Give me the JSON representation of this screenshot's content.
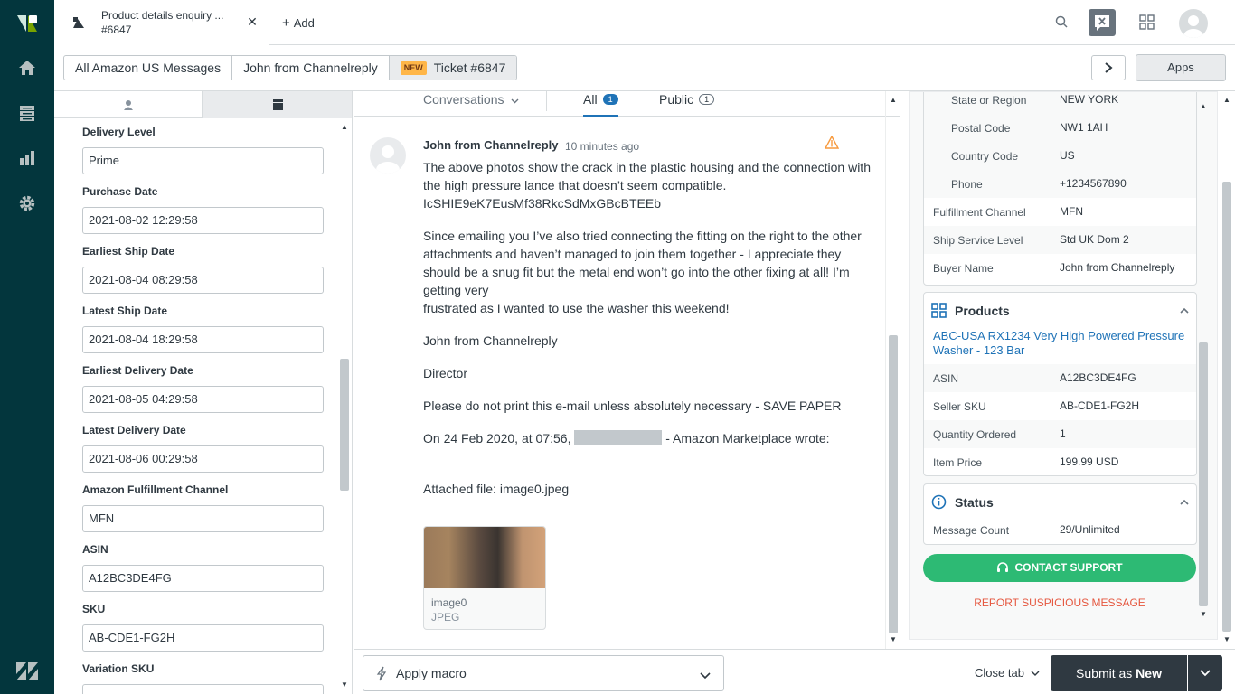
{
  "tabs": {
    "active": {
      "title": "Product details enquiry ...",
      "subtitle": "#6847"
    },
    "add_label": "Add"
  },
  "breadcrumbs": [
    {
      "label": "All Amazon US Messages"
    },
    {
      "label": "John from Channelreply"
    },
    {
      "badge": "NEW",
      "label": "Ticket #6847"
    }
  ],
  "apps_label": "Apps",
  "left_panel": {
    "fields": [
      {
        "label": "Delivery Level",
        "value": "Prime"
      },
      {
        "label": "Purchase Date",
        "value": "2021-08-02 12:29:58"
      },
      {
        "label": "Earliest Ship Date",
        "value": "2021-08-04 08:29:58"
      },
      {
        "label": "Latest Ship Date",
        "value": "2021-08-04 18:29:58"
      },
      {
        "label": "Earliest Delivery Date",
        "value": "2021-08-05 04:29:58"
      },
      {
        "label": "Latest Delivery Date",
        "value": "2021-08-06 00:29:58"
      },
      {
        "label": "Amazon Fulfillment Channel",
        "value": "MFN"
      },
      {
        "label": "ASIN",
        "value": "A12BC3DE4FG"
      },
      {
        "label": "SKU",
        "value": "AB-CDE1-FG2H"
      },
      {
        "label": "Variation SKU",
        "value": ""
      }
    ]
  },
  "conversation": {
    "filter_label": "Conversations",
    "all_label": "All",
    "all_count": "1",
    "public_label": "Public",
    "public_count": "1",
    "message": {
      "author": "John from Channelreply",
      "time": "10 minutes ago",
      "p1": "The above photos show the crack in the plastic housing and the connection with the high pressure lance that doesn’t seem compatible.",
      "p1b": "IcSHIE9eK7EusMf38RkcSdMxGBcBTEEb",
      "p2a": "Since emailing you I’ve also tried connecting the fitting on the right to the other attachments and haven’t managed to join them together - I appreciate they should be a snug fit but the metal end won’t go into the other fixing at all! I’m getting very",
      "p2b": "frustrated as I wanted to use the washer this weekend!",
      "p3": "John from Channelreply",
      "p4": "Director",
      "p5": "Please do not print this e-mail unless absolutely necessary - SAVE PAPER",
      "p6a": "On 24 Feb 2020, at 07:56,",
      "p6b": "- Amazon Marketplace wrote:",
      "p7": "Attached file: image0.jpeg",
      "attachment_name": "image0",
      "attachment_type": "JPEG"
    }
  },
  "bottom": {
    "macro_label": "Apply macro",
    "close_tab_label": "Close tab",
    "submit_prefix": "Submit as",
    "submit_status": "New"
  },
  "right_panel": {
    "address_rows": [
      {
        "key": "State or Region",
        "value": "NEW YORK"
      },
      {
        "key": "Postal Code",
        "value": "NW1 1AH"
      },
      {
        "key": "Country Code",
        "value": "US"
      },
      {
        "key": "Phone",
        "value": "+1234567890"
      }
    ],
    "order_rows": [
      {
        "key": "Fulfillment Channel",
        "value": "MFN"
      },
      {
        "key": "Ship Service Level",
        "value": "Std UK Dom 2"
      },
      {
        "key": "Buyer Name",
        "value": "John from Channelreply"
      }
    ],
    "products": {
      "title": "Products",
      "link": "ABC-USA RX1234 Very High Powered Pressure Washer - 123 Bar",
      "rows": [
        {
          "key": "ASIN",
          "value": "A12BC3DE4FG"
        },
        {
          "key": "Seller SKU",
          "value": "AB-CDE1-FG2H"
        },
        {
          "key": "Quantity Ordered",
          "value": "1"
        },
        {
          "key": "Item Price",
          "value": "199.99 USD"
        }
      ]
    },
    "status": {
      "title": "Status",
      "rows": [
        {
          "key": "Message Count",
          "value": "29/Unlimited"
        }
      ]
    },
    "contact_support": "CONTACT SUPPORT",
    "report": "REPORT SUSPICIOUS MESSAGE"
  },
  "colors": {
    "rail": "#03363d",
    "accent": "#1f73b7",
    "green": "#2dba74",
    "danger": "#e5573f",
    "badge": "#ffb648"
  }
}
